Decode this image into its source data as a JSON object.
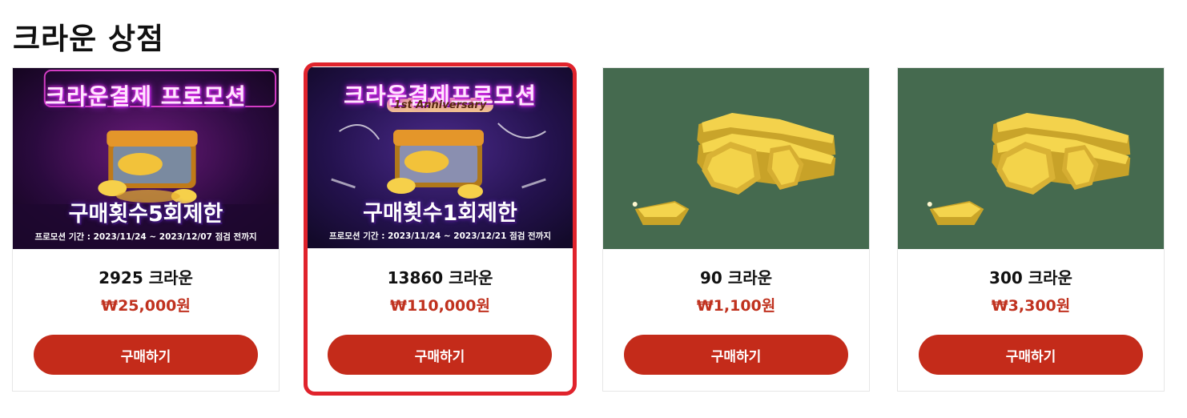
{
  "page": {
    "title": "크라운 상점"
  },
  "products": [
    {
      "name": "2925 크라운",
      "price": "₩25,000원",
      "buy_label": "구매하기",
      "image": {
        "kind": "promo-banner",
        "title": "크라운결제 프로모션",
        "subtitle": "",
        "limit": "구매횟수5회제한",
        "period": "프로모션 기간 : 2023/11/24 ~ 2023/12/07 점검 전까지"
      }
    },
    {
      "name": "13860 크라운",
      "price": "₩110,000원",
      "buy_label": "구매하기",
      "highlighted": true,
      "image": {
        "kind": "promo-banner",
        "title": "크라운결제프로모션",
        "subtitle": "1st Anniversary",
        "limit": "구매횟수1회제한",
        "period": "프로모션 기간 : 2023/11/24 ~ 2023/12/21 점검 전까지"
      }
    },
    {
      "name": "90 크라운",
      "price": "₩1,100원",
      "buy_label": "구매하기",
      "image": {
        "kind": "gold-coins"
      }
    },
    {
      "name": "300 크라운",
      "price": "₩3,300원",
      "buy_label": "구매하기",
      "image": {
        "kind": "gold-coins"
      }
    }
  ],
  "colors": {
    "buy_button": "#c42b1a",
    "price": "#c0321f",
    "highlight_border": "#e0232c",
    "coin_background": "#456a4f"
  }
}
